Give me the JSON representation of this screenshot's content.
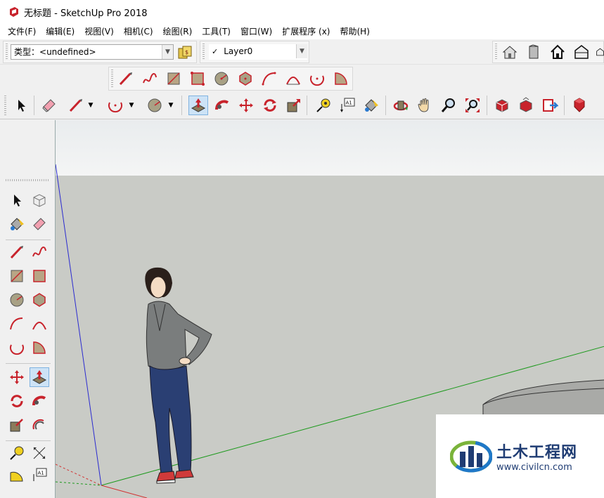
{
  "window": {
    "title": "无标题 - SketchUp Pro 2018"
  },
  "menubar": {
    "items": [
      "文件(F)",
      "编辑(E)",
      "视图(V)",
      "相机(C)",
      "绘图(R)",
      "工具(T)",
      "窗口(W)",
      "扩展程序 (x)",
      "帮助(H)"
    ]
  },
  "toolbar": {
    "type_label": "类型：",
    "type_value": "<undefined>",
    "layer_check": "✓",
    "layer_value": "Layer0",
    "text_tool_label": "A1"
  },
  "lefttools": {
    "text_tool_label": "A1"
  },
  "watermark": {
    "cn": "土木工程网",
    "url": "www.civilcn.com"
  },
  "icons": {
    "select": "arrow-cursor-icon",
    "eraser": "eraser-icon",
    "pencil": "pencil-icon",
    "arc": "arc-icon",
    "circle": "circle-icon",
    "pushpull": "push-pull-icon",
    "followme": "follow-me-icon",
    "move": "move-icon",
    "rotate": "rotate-icon",
    "scale": "scale-icon",
    "tape": "tape-measure-icon",
    "text": "text-icon",
    "paint": "paint-bucket-icon",
    "orbit": "orbit-icon",
    "pan": "pan-hand-icon",
    "zoom": "zoom-icon",
    "zoomext": "zoom-extents-icon",
    "warehouse": "3d-warehouse-icon",
    "ruby": "ruby-icon"
  },
  "colors": {
    "accent_red": "#c8232c",
    "axis_blue": "#2a2ad0",
    "axis_green": "#1e9a1e",
    "axis_red": "#d23232",
    "ground": "#c9cbc6",
    "active_tool": "#cde3f6"
  }
}
